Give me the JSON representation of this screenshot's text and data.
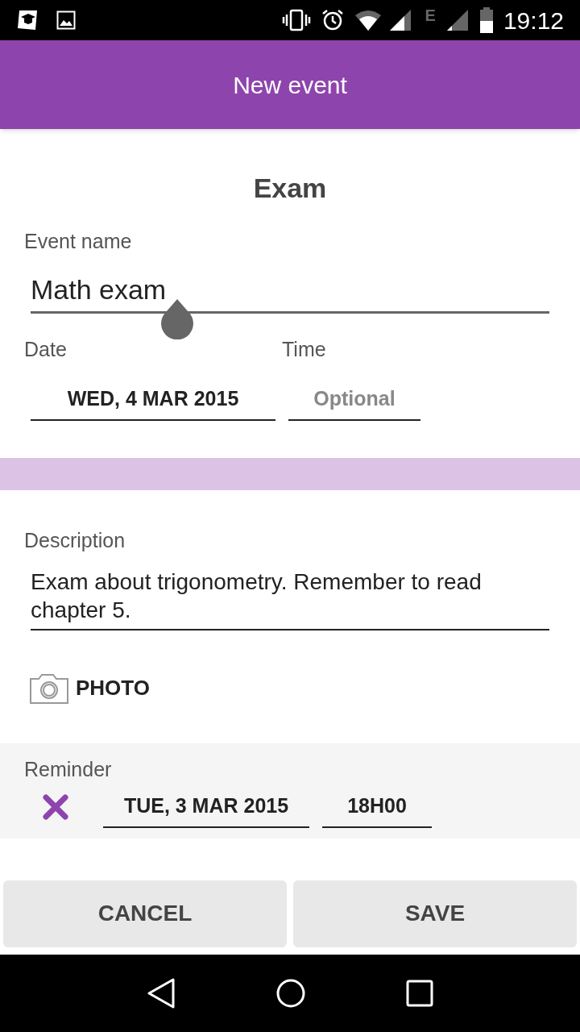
{
  "status_bar": {
    "network_type": "E",
    "time": "19:12"
  },
  "app_bar": {
    "title": "New event"
  },
  "event_type": "Exam",
  "event_name": {
    "label": "Event name",
    "value": "Math exam"
  },
  "date": {
    "label": "Date",
    "value": "WED, 4 MAR 2015"
  },
  "time": {
    "label": "Time",
    "placeholder": "Optional"
  },
  "description": {
    "label": "Description",
    "value": "Exam about trigonometry. Remember to read chapter 5."
  },
  "photo_button": {
    "label": "PHOTO"
  },
  "reminder": {
    "label": "Reminder",
    "date": "TUE, 3 MAR 2015",
    "time": "18H00"
  },
  "buttons": [
    {
      "label": "CANCEL"
    },
    {
      "label": "SAVE"
    }
  ]
}
